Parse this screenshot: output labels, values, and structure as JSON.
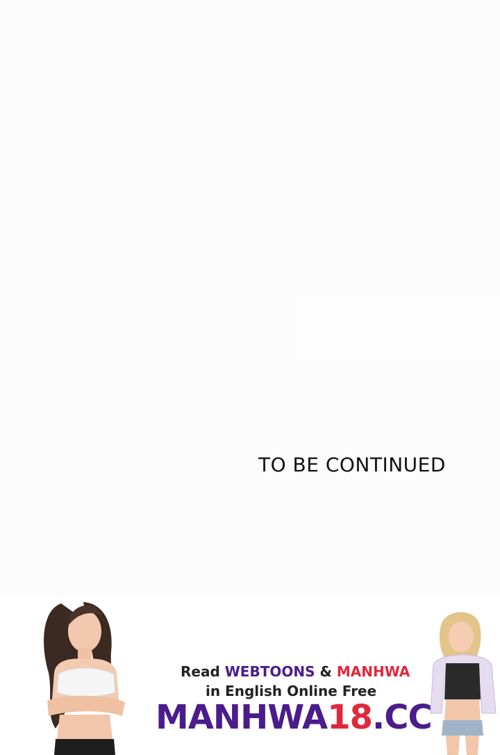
{
  "page": {
    "caption": "TO BE CONTINUED"
  },
  "banner": {
    "line1": {
      "prefix": "Read ",
      "webtoons": "WEBTOONS",
      "amp": " & ",
      "manhwa": "MANHWA"
    },
    "line2": "in English Online Free",
    "logo": {
      "part1": "MANHWA",
      "part2": "18",
      "part3": ".CC"
    }
  },
  "colors": {
    "background": "#fcfcfc",
    "brand_purple": "#4b1c8c",
    "brand_red": "#e0283c",
    "text": "#111111"
  }
}
